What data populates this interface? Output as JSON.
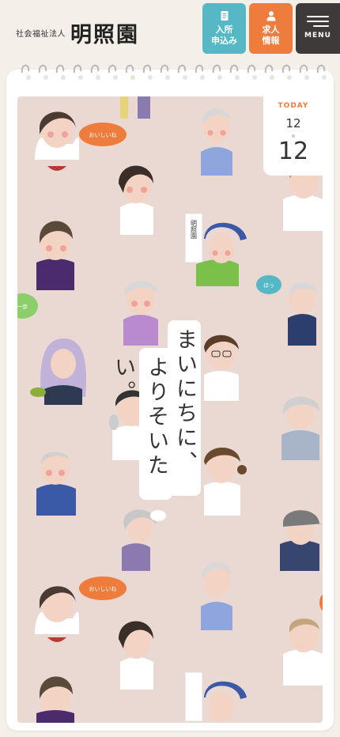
{
  "header": {
    "corp_label": "社会福祉法人",
    "site_name": "明照園",
    "apply_line1": "入所",
    "apply_line2": "申込み",
    "recruit_line1": "求人",
    "recruit_line2": "情報",
    "menu_label": "MENU"
  },
  "calendar": {
    "today_label": "TODAY",
    "month": "12",
    "day": "12"
  },
  "catch_copy": {
    "line1": "まいにちに、",
    "line2": "よりそいたい。"
  },
  "illustration": {
    "speech_bubbles": [
      "おいしいね",
      "ほっ",
      "一歩",
      "おいしいね"
    ],
    "sign_text": "明照園"
  },
  "colors": {
    "background": "#f4efe9",
    "illustration_bg": "#ead8d3",
    "apply_button": "#55b8c4",
    "recruit_button": "#ee7d3d",
    "menu_button": "#3e3a39",
    "today_label": "#ee7d3d"
  }
}
